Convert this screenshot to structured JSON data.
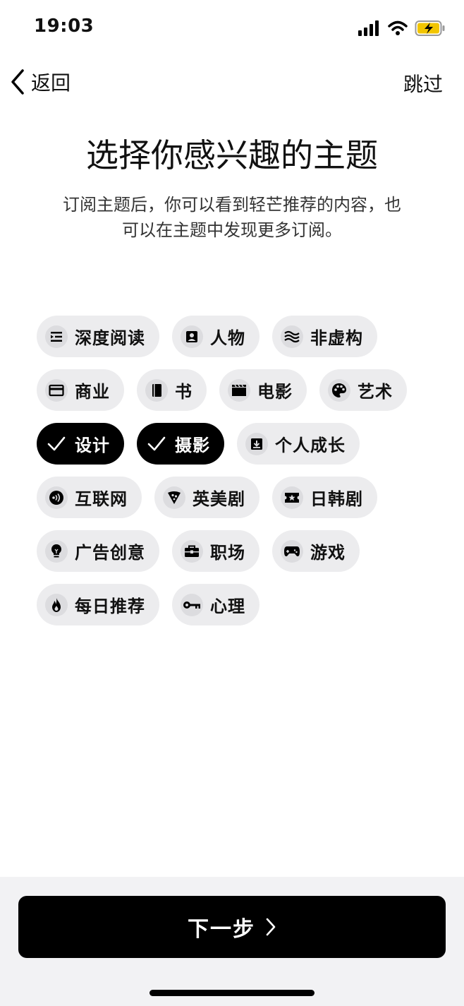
{
  "status_bar": {
    "time": "19:03"
  },
  "nav": {
    "back_label": "返回",
    "skip_label": "跳过"
  },
  "header": {
    "title": "选择你感兴趣的主题",
    "subtitle_line1": "订阅主题后，你可以看到轻芒推荐的内容，也",
    "subtitle_line2": "可以在主题中发现更多订阅。"
  },
  "chips": [
    {
      "label": "深度阅读",
      "icon": "indent-icon",
      "selected": false
    },
    {
      "label": "人物",
      "icon": "contact-icon",
      "selected": false
    },
    {
      "label": "非虚构",
      "icon": "waves-icon",
      "selected": false
    },
    {
      "label": "商业",
      "icon": "credit-card-icon",
      "selected": false
    },
    {
      "label": "书",
      "icon": "book-icon",
      "selected": false
    },
    {
      "label": "电影",
      "icon": "clapperboard-icon",
      "selected": false
    },
    {
      "label": "艺术",
      "icon": "palette-icon",
      "selected": false
    },
    {
      "label": "设计",
      "icon": "check-icon",
      "selected": true
    },
    {
      "label": "摄影",
      "icon": "check-icon",
      "selected": true
    },
    {
      "label": "个人成长",
      "icon": "download-box-icon",
      "selected": false
    },
    {
      "label": "互联网",
      "icon": "broadcast-icon",
      "selected": false
    },
    {
      "label": "英美剧",
      "icon": "pizza-icon",
      "selected": false
    },
    {
      "label": "日韩剧",
      "icon": "ticket-icon",
      "selected": false
    },
    {
      "label": "广告创意",
      "icon": "lightbulb-icon",
      "selected": false
    },
    {
      "label": "职场",
      "icon": "briefcase-icon",
      "selected": false
    },
    {
      "label": "游戏",
      "icon": "gamepad-icon",
      "selected": false
    },
    {
      "label": "每日推荐",
      "icon": "flame-icon",
      "selected": false
    },
    {
      "label": "心理",
      "icon": "key-icon",
      "selected": false
    }
  ],
  "footer": {
    "next_label": "下一步"
  },
  "colors": {
    "chip_bg": "#ececee",
    "selected_bg": "#000000",
    "battery_fill": "#f2c500"
  }
}
